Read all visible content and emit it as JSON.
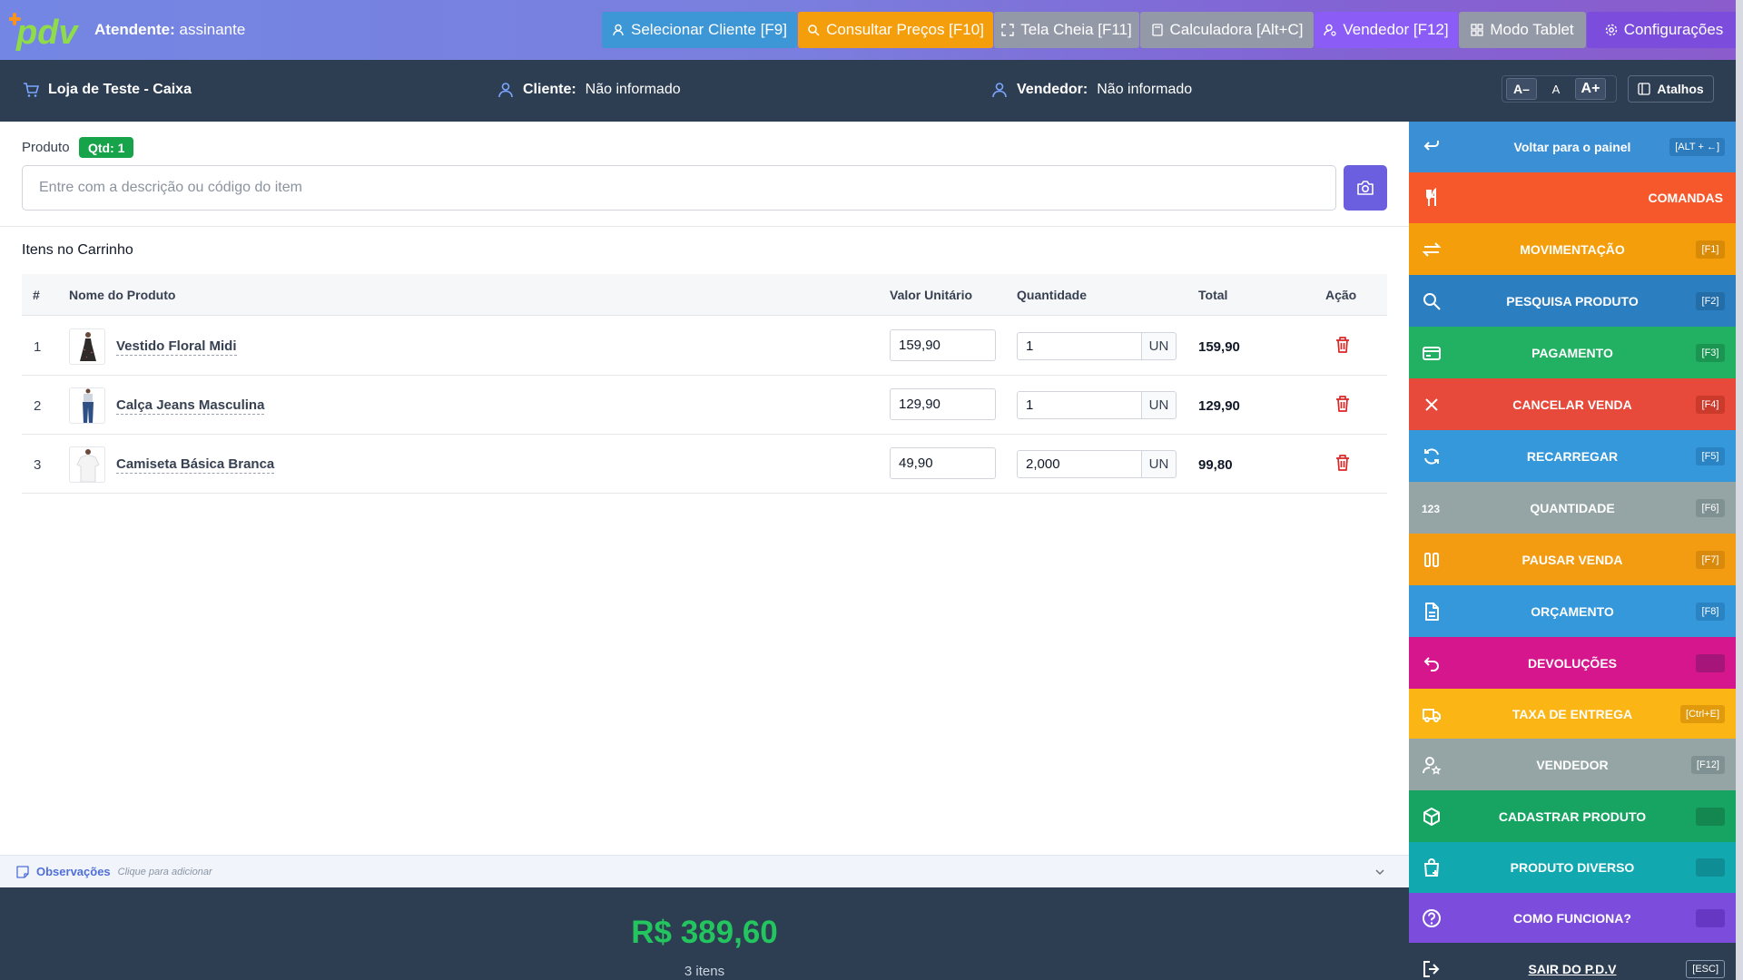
{
  "topbar": {
    "logo_text": "pdv",
    "attendant_label": "Atendente:",
    "attendant_value": "assinante",
    "buttons": [
      {
        "label": "Selecionar Cliente [F9]",
        "color": "#3d97d6"
      },
      {
        "label": "Consultar Preços [F10]",
        "color": "#f59e0b"
      },
      {
        "label": "Tela Cheia [F11]",
        "color": "#9499a8"
      },
      {
        "label": "Calculadora [Alt+C]",
        "color": "#9499a8"
      },
      {
        "label": "Vendedor [F12]",
        "color": "#8b5cf6"
      },
      {
        "label": "Modo Tablet",
        "color": "#9499a8"
      },
      {
        "label": "Configurações",
        "color": "#7c4ddc"
      }
    ]
  },
  "infobar": {
    "store": "Loja de Teste - Caixa",
    "client_label": "Cliente:",
    "client_value": "Não informado",
    "seller_label": "Vendedor:",
    "seller_value": "Não informado",
    "font_small": "A–",
    "font_normal": "A",
    "font_large": "A+",
    "shortcuts": "Atalhos"
  },
  "product": {
    "label": "Produto",
    "qty_badge": "Qtd: 1",
    "search_placeholder": "Entre com a descrição ou código do item"
  },
  "cart": {
    "title": "Itens no Carrinho",
    "columns": [
      "#",
      "Nome do Produto",
      "Valor Unitário",
      "Quantidade",
      "Total",
      "Ação"
    ],
    "rows": [
      {
        "num": "1",
        "name": "Vestido Floral Midi",
        "unit_price": "159,90",
        "qty": "1",
        "unit": "UN",
        "total": "159,90",
        "thumb": "dress"
      },
      {
        "num": "2",
        "name": "Calça Jeans Masculina",
        "unit_price": "129,90",
        "qty": "1",
        "unit": "UN",
        "total": "129,90",
        "thumb": "jeans"
      },
      {
        "num": "3",
        "name": "Camiseta Básica Branca",
        "unit_price": "49,90",
        "qty": "2,000",
        "unit": "UN",
        "total": "99,80",
        "thumb": "tshirt"
      }
    ]
  },
  "observations": {
    "title": "Observações",
    "hint": "Clique para adicionar"
  },
  "summary": {
    "total": "R$ 389,60",
    "items_count": "3 itens"
  },
  "sidemenu": [
    {
      "label": "Voltar para o painel",
      "key": "[ALT + ←]",
      "icon": "return-icon",
      "color": "#3b8fd4",
      "keybg": "#2c7bbd"
    },
    {
      "label": "COMANDAS",
      "key": "",
      "icon": "utensils-icon",
      "color": "#f7582b",
      "keybg": ""
    },
    {
      "label": "MOVIMENTAÇÃO",
      "key": "[F1]",
      "icon": "transfer-icon",
      "color": "#f59e0b",
      "keybg": "#d98a07"
    },
    {
      "label": "PESQUISA PRODUTO",
      "key": "[F2]",
      "icon": "search-icon",
      "color": "#2b7fc1",
      "keybg": "#236da8"
    },
    {
      "label": "PAGAMENTO",
      "key": "[F3]",
      "icon": "card-icon",
      "color": "#22b063",
      "keybg": "#1b9652"
    },
    {
      "label": "CANCELAR VENDA",
      "key": "[F4]",
      "icon": "close-icon",
      "color": "#e74a3b",
      "keybg": "#cc3a2c"
    },
    {
      "label": "RECARREGAR",
      "key": "[F5]",
      "icon": "refresh-icon",
      "color": "#3498db",
      "keybg": "#2a83c2"
    },
    {
      "label": "QUANTIDADE",
      "key": "[F6]",
      "icon": "numbers-icon",
      "color": "#95a5a6",
      "keybg": "#7f9192"
    },
    {
      "label": "PAUSAR VENDA",
      "key": "[F7]",
      "icon": "pause-icon",
      "color": "#f39c12",
      "keybg": "#d9890b"
    },
    {
      "label": "ORÇAMENTO",
      "key": "[F8]",
      "icon": "document-icon",
      "color": "#3498db",
      "keybg": "#2a83c2"
    },
    {
      "label": "DEVOLUÇÕES",
      "key": "",
      "icon": "undo-icon",
      "color": "#d6168d",
      "keybg": "#a6157a"
    },
    {
      "label": "TAXA DE ENTREGA",
      "key": "[Ctrl+E]",
      "icon": "truck-icon",
      "color": "#fbb514",
      "keybg": "#e09a0c"
    },
    {
      "label": "VENDEDOR",
      "key": "[F12]",
      "icon": "user-star-icon",
      "color": "#95a5a6",
      "keybg": "#7f9192"
    },
    {
      "label": "CADASTRAR PRODUTO",
      "key": "",
      "icon": "box-icon",
      "color": "#17a463",
      "keybg": "#13874f"
    },
    {
      "label": "PRODUTO DIVERSO",
      "key": "",
      "icon": "bag-plus-icon",
      "color": "#11a8b0",
      "keybg": "#0f8d94"
    },
    {
      "label": "COMO FUNCIONA?",
      "key": "",
      "icon": "help-icon",
      "color": "#7c4ddc",
      "keybg": "#6537c2"
    },
    {
      "label": "SAIR DO P.D.V",
      "key": "[ESC]",
      "icon": "logout-icon",
      "color": "#2d3d52",
      "keybg": "#2d3d52"
    }
  ]
}
